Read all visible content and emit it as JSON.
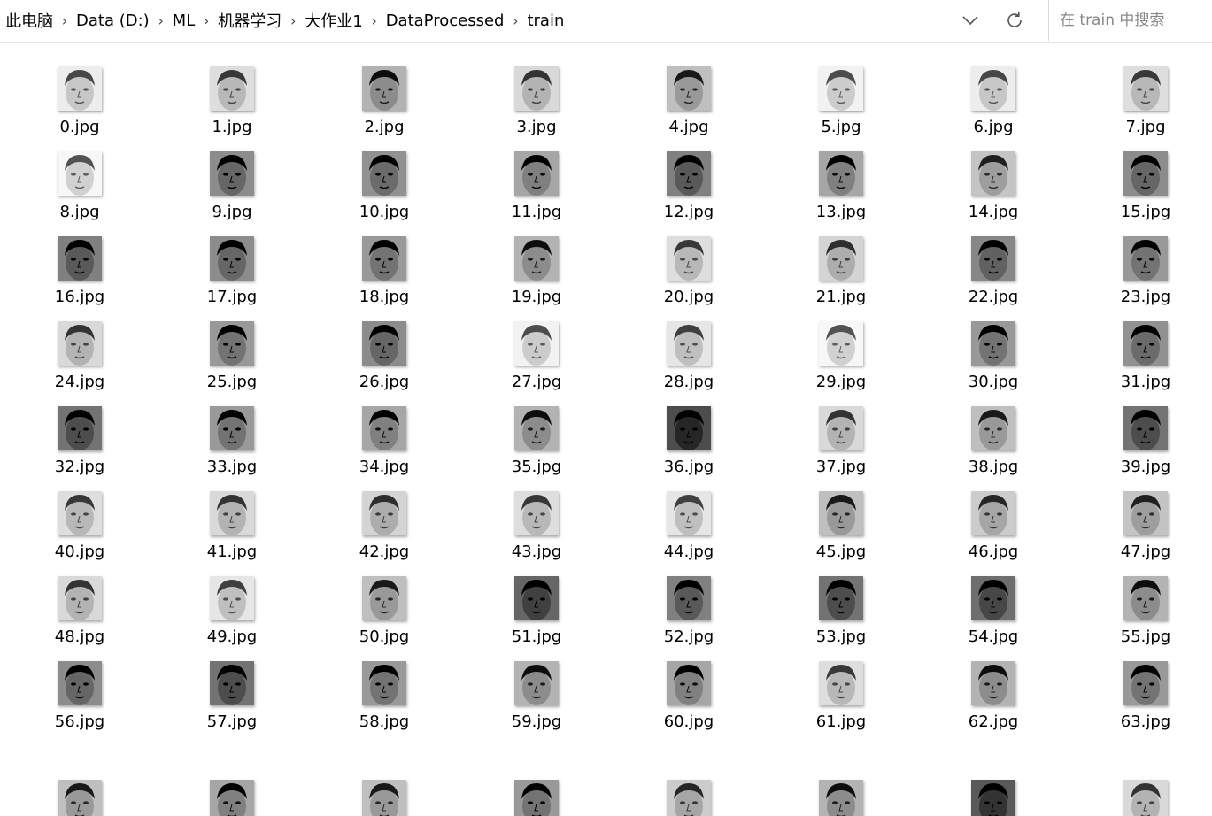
{
  "breadcrumb": {
    "items": [
      "此电脑",
      "Data (D:)",
      "ML",
      "机器学习",
      "大作业1",
      "DataProcessed",
      "train"
    ],
    "separator": "›"
  },
  "search": {
    "placeholder": "在 train 中搜索"
  },
  "icons": {
    "dropdown": "chevron-down-icon",
    "refresh": "refresh-icon"
  },
  "files": [
    {
      "name": "0.jpg",
      "tone": 0.78
    },
    {
      "name": "1.jpg",
      "tone": 0.72
    },
    {
      "name": "2.jpg",
      "tone": 0.55
    },
    {
      "name": "3.jpg",
      "tone": 0.7
    },
    {
      "name": "4.jpg",
      "tone": 0.6
    },
    {
      "name": "5.jpg",
      "tone": 0.8
    },
    {
      "name": "6.jpg",
      "tone": 0.78
    },
    {
      "name": "7.jpg",
      "tone": 0.72
    },
    {
      "name": "8.jpg",
      "tone": 0.82
    },
    {
      "name": "9.jpg",
      "tone": 0.4
    },
    {
      "name": "10.jpg",
      "tone": 0.42
    },
    {
      "name": "11.jpg",
      "tone": 0.5
    },
    {
      "name": "12.jpg",
      "tone": 0.35
    },
    {
      "name": "13.jpg",
      "tone": 0.5
    },
    {
      "name": "14.jpg",
      "tone": 0.62
    },
    {
      "name": "15.jpg",
      "tone": 0.4
    },
    {
      "name": "16.jpg",
      "tone": 0.35
    },
    {
      "name": "17.jpg",
      "tone": 0.4
    },
    {
      "name": "18.jpg",
      "tone": 0.45
    },
    {
      "name": "19.jpg",
      "tone": 0.55
    },
    {
      "name": "20.jpg",
      "tone": 0.72
    },
    {
      "name": "21.jpg",
      "tone": 0.68
    },
    {
      "name": "22.jpg",
      "tone": 0.38
    },
    {
      "name": "23.jpg",
      "tone": 0.45
    },
    {
      "name": "24.jpg",
      "tone": 0.7
    },
    {
      "name": "25.jpg",
      "tone": 0.45
    },
    {
      "name": "26.jpg",
      "tone": 0.4
    },
    {
      "name": "27.jpg",
      "tone": 0.8
    },
    {
      "name": "28.jpg",
      "tone": 0.75
    },
    {
      "name": "29.jpg",
      "tone": 0.82
    },
    {
      "name": "30.jpg",
      "tone": 0.45
    },
    {
      "name": "31.jpg",
      "tone": 0.42
    },
    {
      "name": "32.jpg",
      "tone": 0.3
    },
    {
      "name": "33.jpg",
      "tone": 0.45
    },
    {
      "name": "34.jpg",
      "tone": 0.5
    },
    {
      "name": "35.jpg",
      "tone": 0.55
    },
    {
      "name": "36.jpg",
      "tone": 0.15
    },
    {
      "name": "37.jpg",
      "tone": 0.7
    },
    {
      "name": "38.jpg",
      "tone": 0.6
    },
    {
      "name": "39.jpg",
      "tone": 0.3
    },
    {
      "name": "40.jpg",
      "tone": 0.72
    },
    {
      "name": "41.jpg",
      "tone": 0.7
    },
    {
      "name": "42.jpg",
      "tone": 0.68
    },
    {
      "name": "43.jpg",
      "tone": 0.72
    },
    {
      "name": "44.jpg",
      "tone": 0.75
    },
    {
      "name": "45.jpg",
      "tone": 0.6
    },
    {
      "name": "46.jpg",
      "tone": 0.65
    },
    {
      "name": "47.jpg",
      "tone": 0.62
    },
    {
      "name": "48.jpg",
      "tone": 0.7
    },
    {
      "name": "49.jpg",
      "tone": 0.75
    },
    {
      "name": "50.jpg",
      "tone": 0.6
    },
    {
      "name": "51.jpg",
      "tone": 0.25
    },
    {
      "name": "52.jpg",
      "tone": 0.35
    },
    {
      "name": "53.jpg",
      "tone": 0.3
    },
    {
      "name": "54.jpg",
      "tone": 0.28
    },
    {
      "name": "55.jpg",
      "tone": 0.55
    },
    {
      "name": "56.jpg",
      "tone": 0.4
    },
    {
      "name": "57.jpg",
      "tone": 0.3
    },
    {
      "name": "58.jpg",
      "tone": 0.45
    },
    {
      "name": "59.jpg",
      "tone": 0.55
    },
    {
      "name": "60.jpg",
      "tone": 0.5
    },
    {
      "name": "61.jpg",
      "tone": 0.72
    },
    {
      "name": "62.jpg",
      "tone": 0.55
    },
    {
      "name": "63.jpg",
      "tone": 0.45
    },
    {
      "name": "",
      "tone": 0.6
    },
    {
      "name": "",
      "tone": 0.5
    },
    {
      "name": "",
      "tone": 0.6
    },
    {
      "name": "",
      "tone": 0.45
    },
    {
      "name": "",
      "tone": 0.65
    },
    {
      "name": "",
      "tone": 0.55
    },
    {
      "name": "",
      "tone": 0.2
    },
    {
      "name": "",
      "tone": 0.7
    }
  ]
}
